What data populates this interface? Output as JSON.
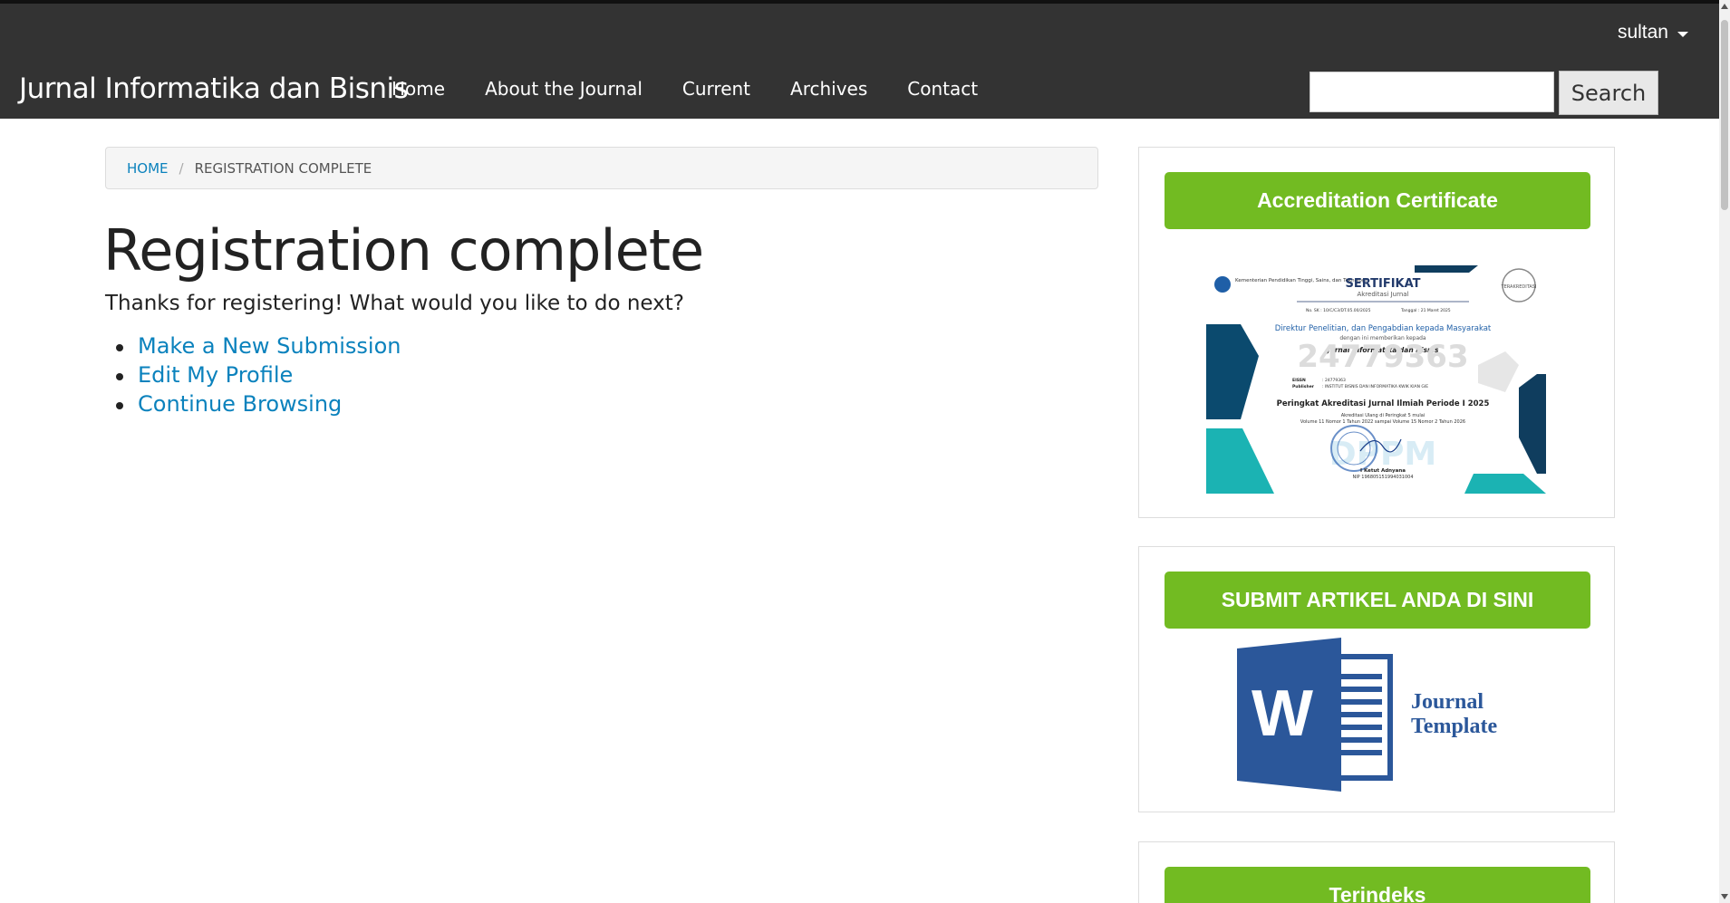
{
  "header": {
    "user": "sultan",
    "site_title": "Jurnal Informatika dan Bisnis",
    "nav": [
      "Home",
      "About the Journal",
      "Current",
      "Archives",
      "Contact"
    ],
    "search_button": "Search",
    "search_value": ""
  },
  "breadcrumb": {
    "home": "Home",
    "current": "Registration Complete"
  },
  "main": {
    "title": "Registration complete",
    "intro": "Thanks for registering! What would you like to do next?",
    "links": [
      "Make a New Submission",
      "Edit My Profile",
      "Continue Browsing"
    ]
  },
  "sidebar": {
    "accreditation_button": "Accreditation Certificate",
    "submit_button": "SUBMIT ARTIKEL ANDA DI SINI",
    "index_button": "Terindeks",
    "certificate": {
      "ministry": "Kementerian Pendidikan Tinggi, Sains, dan Teknologi",
      "title": "SERTIFIKAT",
      "subtitle": "Akreditasi Jurnal",
      "sk_no": "No. SK : 10/C/C3/DT.05.00/2025",
      "date": "Tanggal : 21 Maret 2025",
      "director": "Direktur Penelitian, dan Pengabdian kepada Masyarakat",
      "grant": "dengan ini memberikan kepada",
      "journal": "Jurnal Informatika dan Bisnis",
      "big_number": "24779363",
      "eissn_label": "EISSN",
      "eissn": ": 24779363",
      "publisher_label": "Publisher",
      "publisher": ": INSTITUT BISNIS DAN INFORMATIKA KWIK KIAN GIE",
      "rank": "Peringkat Akreditasi Jurnal Ilmiah Periode I 2025",
      "validity_1": "Akreditasi Ulang di Peringkat 5 mulai",
      "validity_2": "Volume 11 Nomor 1 Tahun 2022 sampai Volume 15 Nomor 2 Tahun 2026",
      "watermark": "DPPM",
      "signer": "I Ketut Adnyana",
      "nip": "NIP 196805151994031004",
      "badge": "TERAKREDITASI"
    },
    "template": {
      "icon_letter": "W",
      "line1": "Journal",
      "line2": "Template"
    }
  },
  "colors": {
    "topbar": "#333333",
    "accent_green": "#72bb22",
    "link_blue": "#0b82bd",
    "word_blue": "#2b579a"
  }
}
